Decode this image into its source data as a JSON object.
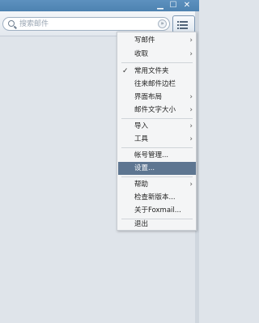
{
  "window": {
    "minimize_glyph": "▁",
    "maximize_glyph": "☐",
    "close_glyph": "✕"
  },
  "search": {
    "placeholder": "搜索邮件",
    "dropdown_glyph": "»"
  },
  "menu": {
    "items": [
      {
        "label": "写邮件",
        "submenu": true
      },
      {
        "label": "收取",
        "submenu": true
      },
      {
        "label": "常用文件夹",
        "checked": true
      },
      {
        "label": "往来邮件边栏"
      },
      {
        "label": "界面布局",
        "submenu": true
      },
      {
        "label": "邮件文字大小",
        "submenu": true
      },
      {
        "label": "导入",
        "submenu": true
      },
      {
        "label": "工具",
        "submenu": true
      },
      {
        "label": "帐号管理..."
      },
      {
        "label": "设置...",
        "highlighted": true
      },
      {
        "label": "帮助",
        "submenu": true
      },
      {
        "label": "检查新版本..."
      },
      {
        "label": "关于Foxmail..."
      },
      {
        "label": "退出"
      }
    ],
    "submenu_glyph": "›",
    "check_glyph": "✓"
  }
}
